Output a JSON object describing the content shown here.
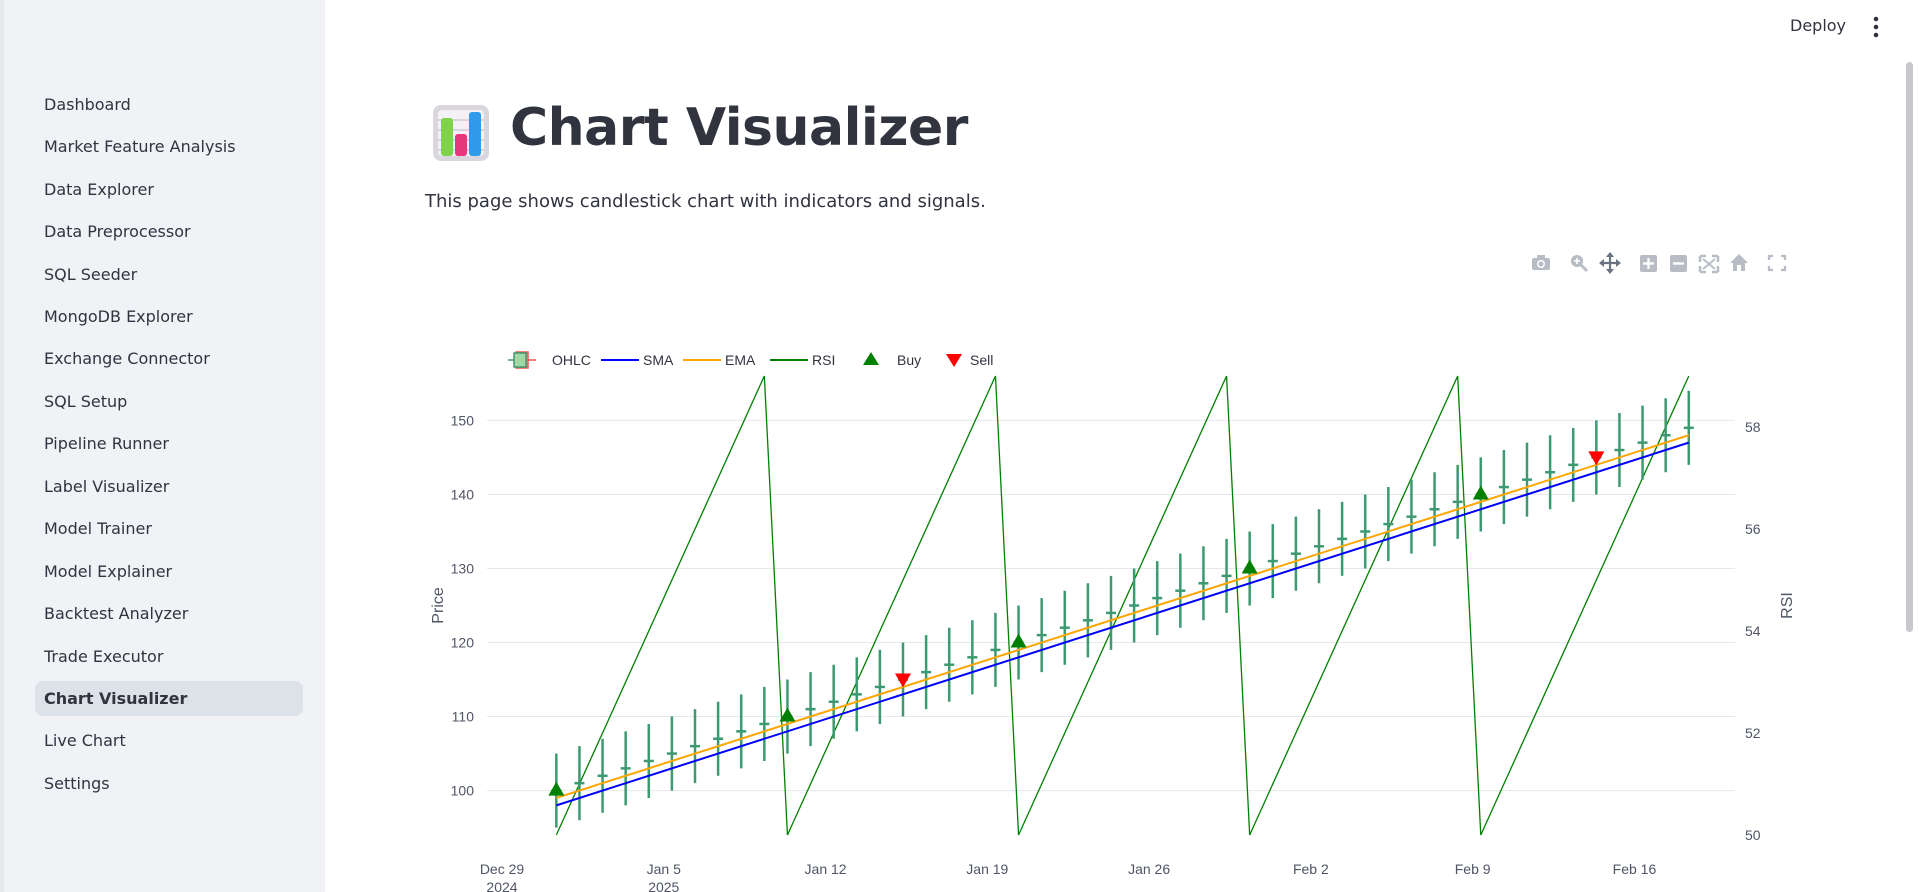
{
  "sidebar": {
    "items": [
      {
        "label": "Dashboard"
      },
      {
        "label": "Market Feature Analysis"
      },
      {
        "label": "Data Explorer"
      },
      {
        "label": "Data Preprocessor"
      },
      {
        "label": "SQL Seeder"
      },
      {
        "label": "MongoDB Explorer"
      },
      {
        "label": "Exchange Connector"
      },
      {
        "label": "SQL Setup"
      },
      {
        "label": "Pipeline Runner"
      },
      {
        "label": "Label Visualizer"
      },
      {
        "label": "Model Trainer"
      },
      {
        "label": "Model Explainer"
      },
      {
        "label": "Backtest Analyzer"
      },
      {
        "label": "Trade Executor"
      },
      {
        "label": "Chart Visualizer",
        "active": true
      },
      {
        "label": "Live Chart"
      },
      {
        "label": "Settings"
      }
    ]
  },
  "header": {
    "deploy_label": "Deploy",
    "menu_icon": "more-vertical-icon"
  },
  "page": {
    "icon": "bar-chart-emoji-icon",
    "title": "Chart Visualizer",
    "description": "This page shows candlestick chart with indicators and signals."
  },
  "modebar": {
    "icons": [
      "camera-icon",
      "zoom-icon",
      "pan-icon",
      "zoom-in-icon",
      "zoom-out-icon",
      "autoscale-icon",
      "home-icon",
      "fullscreen-icon"
    ]
  },
  "colors": {
    "sma": "#0000ff",
    "ema": "#ffa500",
    "rsi": "#008000",
    "buy": "#008000",
    "sell": "#ff0000",
    "candle_up": "#3d9970",
    "candle_down": "#ef5350",
    "active_nav": "#dde1e8",
    "sidebar_bg": "#f0f2f6"
  },
  "chart_data": {
    "type": "candlestick",
    "legend": [
      "OHLC",
      "SMA",
      "EMA",
      "RSI",
      "Buy",
      "Sell"
    ],
    "legend_position": "top-left",
    "ylabel": "Price",
    "y2label": "RSI",
    "ylim": [
      94,
      156
    ],
    "y2lim": [
      50,
      59
    ],
    "yticks": [
      100,
      110,
      120,
      130,
      140,
      150
    ],
    "y2ticks": [
      50,
      52,
      54,
      56,
      58
    ],
    "xlim": [
      "2024-12-29",
      "2025-02-21"
    ],
    "xticks": [
      {
        "line1": "Dec 29",
        "line2": "2024"
      },
      {
        "line1": "Jan 5",
        "line2": "2025"
      },
      {
        "line1": "Jan 12",
        "line2": ""
      },
      {
        "line1": "Jan 19",
        "line2": ""
      },
      {
        "line1": "Jan 26",
        "line2": ""
      },
      {
        "line1": "Feb 2",
        "line2": ""
      },
      {
        "line1": "Feb 9",
        "line2": ""
      },
      {
        "line1": "Feb 16",
        "line2": ""
      }
    ],
    "start_date": "2025-01-01",
    "ohlc": {
      "open": [
        100,
        101,
        102,
        103,
        104,
        105,
        106,
        107,
        108,
        109,
        110,
        111,
        112,
        113,
        114,
        115,
        116,
        117,
        118,
        119,
        120,
        121,
        122,
        123,
        124,
        125,
        126,
        127,
        128,
        129,
        130,
        131,
        132,
        133,
        134,
        135,
        136,
        137,
        138,
        139,
        140,
        141,
        142,
        143,
        144,
        145,
        146,
        147,
        148,
        149
      ],
      "high": [
        105,
        106,
        107,
        108,
        109,
        110,
        111,
        112,
        113,
        114,
        115,
        116,
        117,
        118,
        119,
        120,
        121,
        122,
        123,
        124,
        125,
        126,
        127,
        128,
        129,
        130,
        131,
        132,
        133,
        134,
        135,
        136,
        137,
        138,
        139,
        140,
        141,
        142,
        143,
        144,
        145,
        146,
        147,
        148,
        149,
        150,
        151,
        152,
        153,
        154
      ],
      "low": [
        95,
        96,
        97,
        98,
        99,
        100,
        101,
        102,
        103,
        104,
        105,
        106,
        107,
        108,
        109,
        110,
        111,
        112,
        113,
        114,
        115,
        116,
        117,
        118,
        119,
        120,
        121,
        122,
        123,
        124,
        125,
        126,
        127,
        128,
        129,
        130,
        131,
        132,
        133,
        134,
        135,
        136,
        137,
        138,
        139,
        140,
        141,
        142,
        143,
        144
      ],
      "close": [
        100,
        101,
        102,
        103,
        104,
        105,
        106,
        107,
        108,
        109,
        110,
        111,
        112,
        113,
        114,
        115,
        116,
        117,
        118,
        119,
        120,
        121,
        122,
        123,
        124,
        125,
        126,
        127,
        128,
        129,
        130,
        131,
        132,
        133,
        134,
        135,
        136,
        137,
        138,
        139,
        140,
        141,
        142,
        143,
        144,
        145,
        146,
        147,
        148,
        149
      ]
    },
    "sma": {
      "start": 98,
      "end": 147
    },
    "ema": {
      "start": 99,
      "end": 148
    },
    "rsi": {
      "period": 10,
      "min": 50,
      "max": 59
    },
    "buy_signals": [
      {
        "day": 0,
        "price": 100
      },
      {
        "day": 10,
        "price": 110
      },
      {
        "day": 20,
        "price": 120
      },
      {
        "day": 30,
        "price": 130
      },
      {
        "day": 40,
        "price": 140
      }
    ],
    "sell_signals": [
      {
        "day": 15,
        "price": 115
      },
      {
        "day": 45,
        "price": 145
      }
    ]
  }
}
